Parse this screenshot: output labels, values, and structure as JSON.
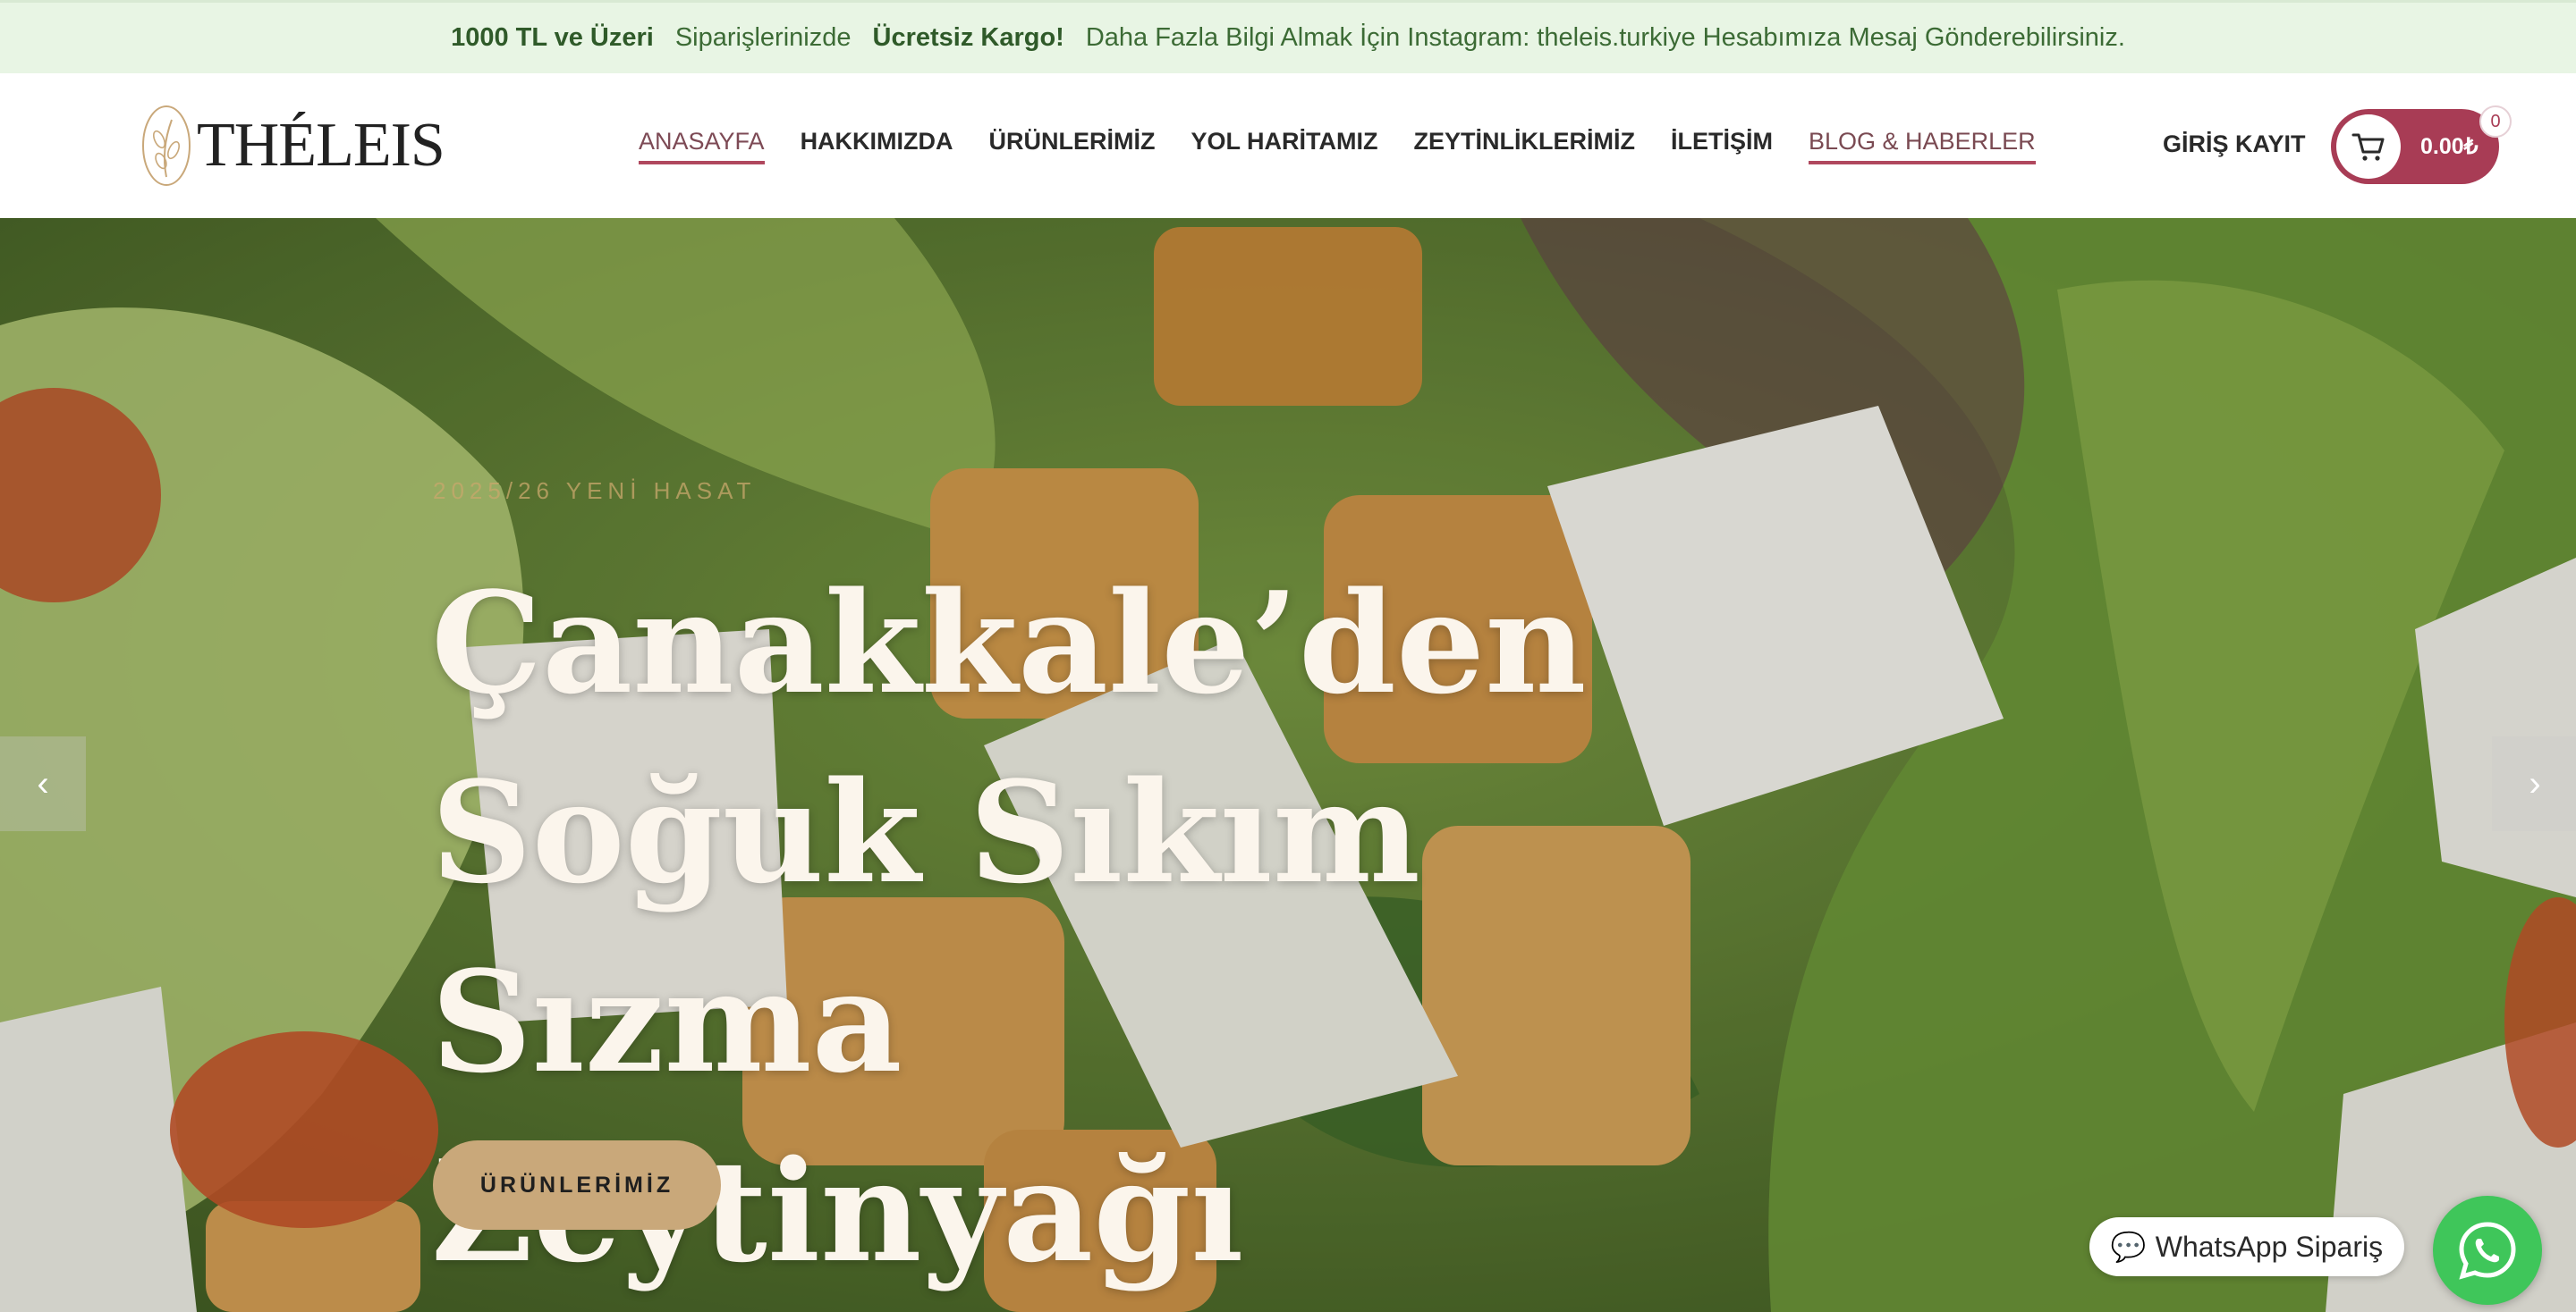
{
  "topbar": {
    "part1": "1000 TL ve Üzeri",
    "part2": "Siparişlerinizde",
    "part3": "Ücretsiz Kargo!",
    "part4": "Daha Fazla Bilgi Almak İçin Instagram: theleis.turkiye Hesabımıza Mesaj Gönderebilirsiniz."
  },
  "header": {
    "logo_text": "THÉLEIS",
    "nav": [
      {
        "label": "ANASAYFA"
      },
      {
        "label": "HAKKIMIZDA"
      },
      {
        "label": "ÜRÜNLERİMİZ"
      },
      {
        "label": "YOL HARİTAMIZ"
      },
      {
        "label": "ZEYTİNLİKLERİMİZ"
      },
      {
        "label": "İLETİŞİM"
      },
      {
        "label": "BLOG & HABERLER"
      }
    ],
    "auth_label": "GİRİŞ KAYIT",
    "cart_total": "0.00₺",
    "cart_count": "0"
  },
  "hero": {
    "eyebrow": "2025/26 YENİ HASAT",
    "headline_line1": "Çanakkale’den",
    "headline_line2": "Soğuk Sıkım",
    "headline_line3": "Sızma Zeytinyağı",
    "button_label": "ÜRÜNLERİMİZ",
    "prev_arrow": "‹",
    "next_arrow": "›"
  },
  "whatsapp": {
    "label_icon": "💬",
    "label": "WhatsApp Sipariş"
  },
  "colors": {
    "accent": "#a83c55",
    "topbar_bg": "#e8f5e4",
    "button_gold": "#c9a87a",
    "whatsapp_green": "#3fc65a"
  },
  "icons": [
    "cart-icon",
    "whatsapp-icon",
    "chat-bubble-icon",
    "chevron-left-icon",
    "chevron-right-icon"
  ]
}
